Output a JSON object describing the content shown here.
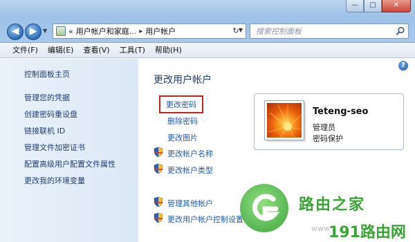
{
  "window": {
    "minimize": "—",
    "maximize": "□",
    "close": "✕"
  },
  "nav": {
    "back": "◀",
    "forward": "▶"
  },
  "address": {
    "prefix": "«",
    "crumb1": "用户帐户和家庭...",
    "sep": "▸",
    "crumb2": "用户帐户"
  },
  "search": {
    "placeholder": "搜索控制面板"
  },
  "menu": [
    "文件(F)",
    "编辑(E)",
    "查看(V)",
    "工具(T)",
    "帮助(H)"
  ],
  "left_links": [
    "控制面板主页",
    "管理您的凭据",
    "创建密码重设盘",
    "链接联机 ID",
    "管理文件加密证书",
    "配置高级用户配置文件属性",
    "更改我的环境变量"
  ],
  "main": {
    "title": "更改用户帐户",
    "tasks": {
      "change_password": "更改密码",
      "remove_password": "删除密码",
      "change_picture": "更改图片",
      "change_account_name": "更改帐户名称",
      "change_account_type": "更改帐户类型",
      "manage_other": "管理其他帐户",
      "uac_settings": "更改用户帐户控制设置"
    },
    "help": "?"
  },
  "user": {
    "name": "Teteng-seo",
    "role": "管理员",
    "status": "密码保护"
  },
  "watermark": {
    "brand1": "路由之家",
    "brand2": "191路由网",
    "site": "www"
  },
  "colors": {
    "link": "#1e5aa8",
    "highlight_border": "#c8201c",
    "title": "#1e3d6e",
    "watermark": "#3aa335"
  }
}
